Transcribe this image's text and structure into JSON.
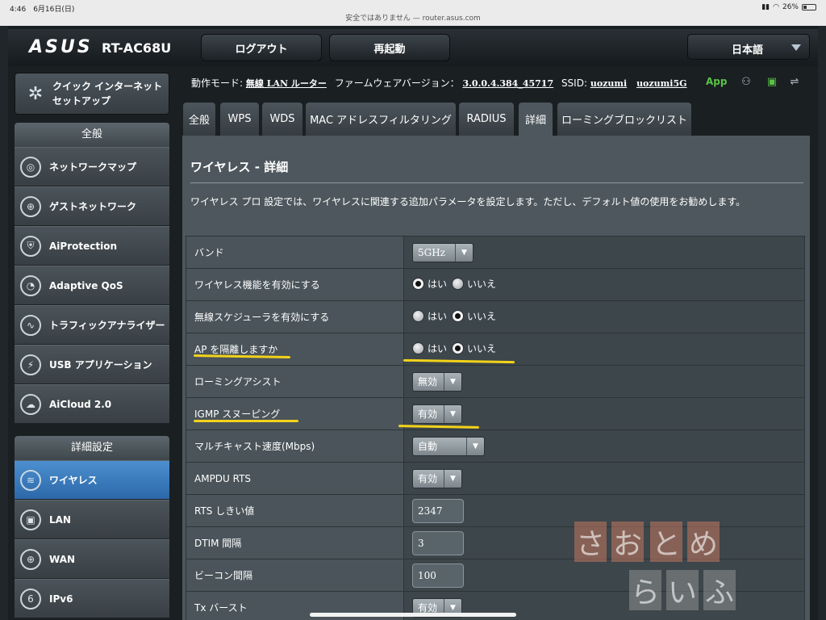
{
  "status_bar": {
    "time": "4:46　6月16日(日)",
    "url_text": "安全ではありません — router.asus.com",
    "battery": "26%"
  },
  "header": {
    "brand": "ASUS",
    "model": "RT-AC68U",
    "logout": "ログアウト",
    "reboot": "再起動",
    "language": "日本語"
  },
  "sidebar": {
    "quick_setup": [
      "クイック インターネット",
      "セットアップ"
    ],
    "general_title": "全般",
    "general_items": [
      {
        "label": "ネットワークマップ",
        "icon": "network-map-icon",
        "glyph": "◎"
      },
      {
        "label": "ゲストネットワーク",
        "icon": "guest-network-icon",
        "glyph": "⊕"
      },
      {
        "label": "AiProtection",
        "icon": "shield-lock-icon",
        "glyph": "⛨"
      },
      {
        "label": "Adaptive QoS",
        "icon": "speedometer-icon",
        "glyph": "◔"
      },
      {
        "label": "トラフィックアナライザー",
        "icon": "traffic-analyzer-icon",
        "glyph": "∿"
      },
      {
        "label": "USB アプリケーション",
        "icon": "usb-app-icon",
        "glyph": "⚡"
      },
      {
        "label": "AiCloud 2.0",
        "icon": "cloud-icon",
        "glyph": "☁"
      }
    ],
    "advanced_title": "詳細設定",
    "advanced_items": [
      {
        "label": "ワイヤレス",
        "icon": "wireless-icon",
        "glyph": "≋",
        "active": true
      },
      {
        "label": "LAN",
        "icon": "lan-icon",
        "glyph": "▣"
      },
      {
        "label": "WAN",
        "icon": "wan-globe-icon",
        "glyph": "⊕"
      },
      {
        "label": "IPv6",
        "icon": "ipv6-icon",
        "glyph": "6"
      }
    ]
  },
  "info": {
    "mode_label": "動作モード:",
    "mode_value": "無線 LAN ルーター",
    "fw_label": "ファームウェアバージョン：",
    "fw_value": "3.0.0.4.384_45717",
    "ssid_label": "SSID:",
    "ssid1": "uozumi",
    "ssid2": "uozumi5G",
    "app": "App"
  },
  "tabs": [
    "全般",
    "WPS",
    "WDS",
    "MAC アドレスフィルタリング",
    "RADIUS",
    "詳細",
    "ローミングブロックリスト"
  ],
  "panel": {
    "title": "ワイヤレス - 詳細",
    "description": "ワイヤレス プロ 設定では、ワイヤレスに関連する追加パラメータを設定します。ただし、デフォルト値の使用をお勧めします。"
  },
  "settings": [
    {
      "label": "バンド",
      "type": "select",
      "value": "5GHz"
    },
    {
      "label": "ワイヤレス機能を有効にする",
      "type": "radio",
      "yes": "はい",
      "no": "いいえ",
      "selected": "yes"
    },
    {
      "label": "無線スケジューラを有効にする",
      "type": "radio",
      "yes": "はい",
      "no": "いいえ",
      "selected": "no"
    },
    {
      "label": "AP を隔離しますか",
      "type": "radio",
      "yes": "はい",
      "no": "いいえ",
      "selected": "no"
    },
    {
      "label": "ローミングアシスト",
      "type": "select",
      "value": "無効"
    },
    {
      "label": "IGMP スヌーピング",
      "type": "select",
      "value": "有効"
    },
    {
      "label": "マルチキャスト速度(Mbps)",
      "type": "select",
      "value": "自動"
    },
    {
      "label": "AMPDU RTS",
      "type": "select",
      "value": "有効"
    },
    {
      "label": "RTS しきい値",
      "type": "text",
      "value": "2347"
    },
    {
      "label": "DTIM 間隔",
      "type": "text",
      "value": "3"
    },
    {
      "label": "ビーコン間隔",
      "type": "text",
      "value": "100"
    },
    {
      "label": "Tx バースト",
      "type": "select",
      "value": "有効"
    }
  ],
  "watermark": [
    "さ",
    "お",
    "と",
    "め",
    "ら",
    "い",
    "ふ"
  ]
}
